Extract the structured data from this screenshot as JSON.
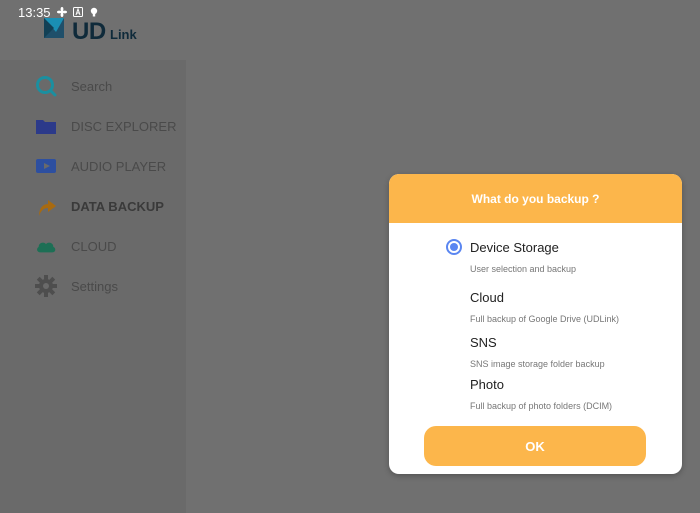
{
  "status_bar": {
    "time": "13:35"
  },
  "logo": {
    "ud": "UD",
    "link": "Link"
  },
  "menu": [
    {
      "label": "Search",
      "icon": "search-icon"
    },
    {
      "label": "DISC EXPLORER",
      "icon": "folder-icon"
    },
    {
      "label": "AUDIO PLAYER",
      "icon": "play-icon"
    },
    {
      "label": "DATA BACKUP",
      "icon": "backup-arrow-icon",
      "active": true
    },
    {
      "label": "CLOUD",
      "icon": "cloud-icon"
    },
    {
      "label": "Settings",
      "icon": "gear-icon"
    }
  ],
  "dialog": {
    "title": "What do you backup ?",
    "options": [
      {
        "title": "Device Storage",
        "desc": "User selection and backup",
        "selected": true
      },
      {
        "title": "Cloud",
        "desc": "Full backup of Google Drive (UDLink)",
        "selected": false
      },
      {
        "title": "SNS",
        "desc": "SNS image storage folder backup",
        "selected": false
      },
      {
        "title": "Photo",
        "desc": "Full backup of photo folders (DCIM)",
        "selected": false
      }
    ],
    "ok_label": "OK"
  },
  "colors": {
    "accent": "#fcb64b",
    "radio": "#5a86f1",
    "search_icon": "#1b8fa0",
    "folder_icon": "#2c3a8a",
    "play_icon": "#2d4fa0",
    "backup_icon": "#a86a10",
    "cloud_icon": "#1d6f55",
    "gear_icon": "#4e4e4e"
  }
}
